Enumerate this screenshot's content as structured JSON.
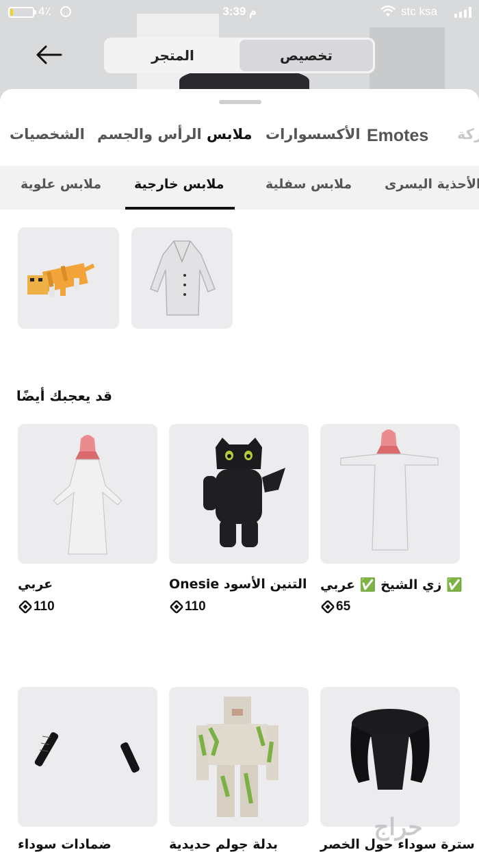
{
  "status_bar": {
    "battery_pct": "4٪",
    "battery_level": 0.12,
    "time": "3:39 م",
    "carrier": "stc ksa"
  },
  "header": {
    "segments": [
      {
        "label": "تخصيص",
        "active": true
      },
      {
        "label": "المتجر",
        "active": false
      }
    ]
  },
  "category_tabs": [
    {
      "label": "الشخصيات",
      "active": false
    },
    {
      "label": "الرأس والجسم",
      "active": false
    },
    {
      "label": "ملابس",
      "active": true
    },
    {
      "label": "الأكسسوارات",
      "active": false
    },
    {
      "label": "Emotes",
      "active": false
    },
    {
      "label": "حركة",
      "active": false
    }
  ],
  "sub_tabs": [
    {
      "label": "ملابس علوية",
      "active": false
    },
    {
      "label": "ملابس خارجية",
      "active": true
    },
    {
      "label": "ملابس سفلية",
      "active": false
    },
    {
      "label": "الأحذية اليسرى",
      "active": false
    }
  ],
  "owned_items": [
    {
      "name": "orange-cat-item"
    },
    {
      "name": "white-coat-item"
    }
  ],
  "recommendations": {
    "title": "قد يعجبك أيضًا",
    "items": [
      {
        "name": "عربي",
        "price": "110"
      },
      {
        "name": "التنين الأسود Onesie",
        "price": "110"
      },
      {
        "name_prefix": "✅ عربي",
        "name_suffix": "✅ زي الشيخ",
        "price": "65"
      },
      {
        "name": "ضمادات سوداء"
      },
      {
        "name": "بدلة جولم حديدية"
      },
      {
        "name": "سترة سوداء حول الخصر"
      }
    ]
  },
  "watermark": "حراج"
}
